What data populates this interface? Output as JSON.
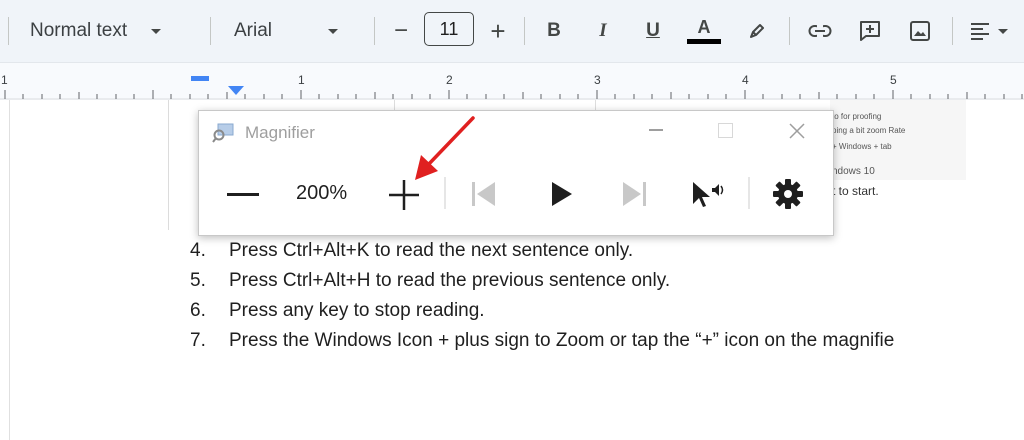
{
  "toolbar": {
    "style_label": "Normal text",
    "font_label": "Arial",
    "font_size": "11",
    "decrease_label": "−",
    "increase_label": "+",
    "bold_label": "B",
    "italic_label": "I",
    "underline_label": "U",
    "text_color_label": "A"
  },
  "ruler": {
    "numbers": [
      "1",
      "1",
      "2",
      "3",
      "4",
      "5"
    ]
  },
  "magnifier_bg_text": [
    "ndows 10",
    "t to start.",
    "+ Windows + tab",
    "ping a bit zoom Rate",
    "to for proofing"
  ],
  "magnifier": {
    "title": "Magnifier",
    "zoom_level": "200%"
  },
  "list": [
    {
      "num": "4.",
      "text": "Press Ctrl+Alt+K to read the next sentence only."
    },
    {
      "num": "5.",
      "text": "Press Ctrl+Alt+H to read the previous sentence only."
    },
    {
      "num": "6.",
      "text": "Press any key to stop reading."
    },
    {
      "num": "7.",
      "text": "Press the Windows Icon + plus sign to Zoom or tap the “+” icon on the magnifie"
    }
  ],
  "colors": {
    "toolbar_bg": "#f0f4f9",
    "annotation_arrow": "#e02020",
    "indent_marker": "#4285f4"
  }
}
